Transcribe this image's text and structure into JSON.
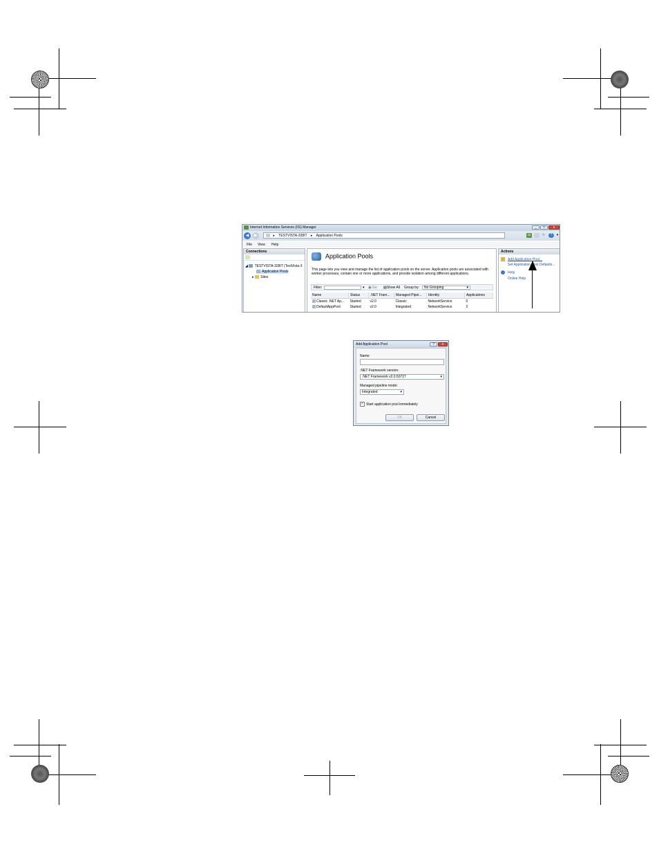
{
  "iis_window": {
    "title": "Internet Information Services (IIS) Manager",
    "breadcrumb": [
      "TESTVISTA-328IT",
      "Application Pools"
    ],
    "menu": [
      "File",
      "View",
      "Help"
    ],
    "connections": {
      "header": "Connections",
      "tree": {
        "server": "TESTVISTA-328IT (TestVista-3",
        "application_pools": "Application Pools",
        "sites": "Sites"
      }
    },
    "center": {
      "page_title": "Application Pools",
      "description": "This page lets you view and manage the list of application pools on the server. Application pools are associated with worker processes, contain one or more applications, and provide isolation among different applications.",
      "filter_label": "Filter:",
      "go_label": "Go",
      "show_all_label": "Show All",
      "group_by_label": "Group by:",
      "group_by_value": "No Grouping",
      "columns": [
        "Name",
        "Status",
        ".NET Fram...",
        "Managed Pipel...",
        "Identity",
        "Applications"
      ],
      "rows": [
        [
          "Classic .NET Ap...",
          "Started",
          "v2.0",
          "Classic",
          "NetworkService",
          "0"
        ],
        [
          "DefaultAppPool",
          "Started",
          "v2.0",
          "Integrated",
          "NetworkService",
          "2"
        ]
      ]
    },
    "actions": {
      "header": "Actions",
      "add_app_pool": "Add Application Pool...",
      "set_defaults": "Set Application Pool Defaults...",
      "help": "Help",
      "online_help": "Online Help"
    }
  },
  "dialog": {
    "title": "Add Application Pool",
    "help_button": "?",
    "close_button": "x",
    "name_label": "Name:",
    "name_value": "",
    "framework_label": ".NET Framework version:",
    "framework_value": ".NET Framework v2.0.50727",
    "pipeline_label": "Managed pipeline mode:",
    "pipeline_value": "Integrated",
    "start_checkbox_label": "Start application pool immediately",
    "start_checked": true,
    "ok_label": "OK",
    "cancel_label": "Cancel"
  },
  "colors": {
    "titlebar": "#c7d4e2",
    "link": "#1a56b0",
    "close_button": "#c94b3c"
  }
}
